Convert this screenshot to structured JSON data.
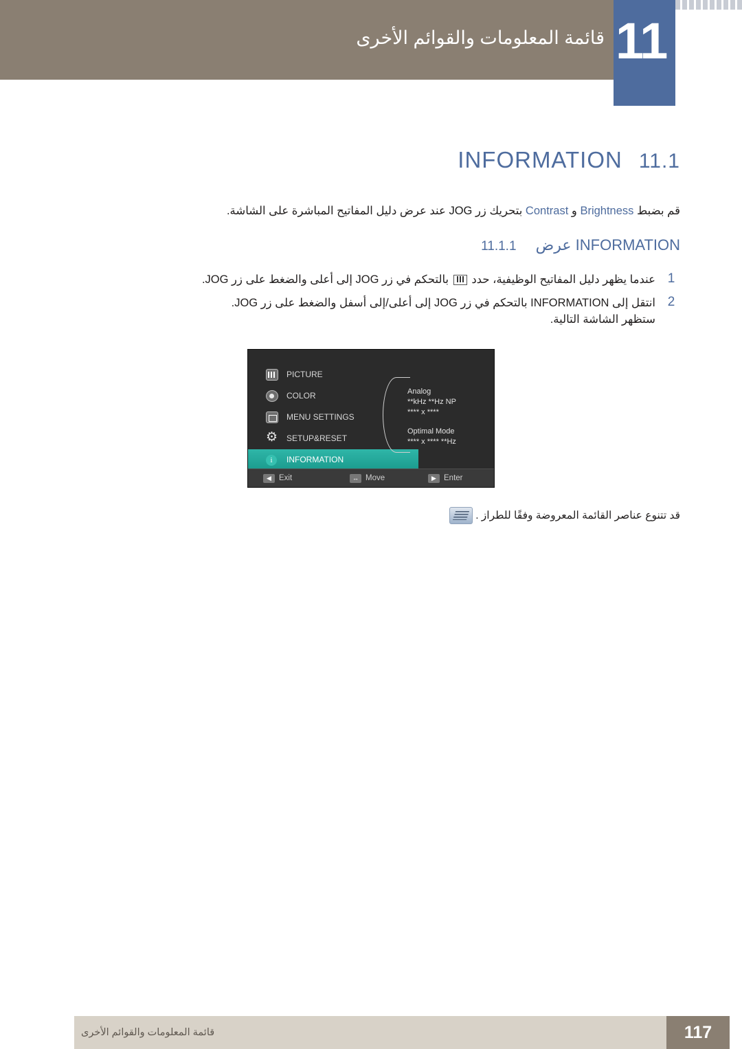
{
  "header": {
    "chapter_number": "11",
    "chapter_title": "قائمة المعلومات والقوائم الأخرى"
  },
  "section": {
    "title_en": "INFORMATION",
    "number": "11.1"
  },
  "lead": {
    "part_right": "قم بضبط",
    "brightness": "Brightness",
    "and": "و",
    "contrast": "Contrast",
    "part_middle": "بتحريك زر",
    "jog": "JOG",
    "part_left": "عند عرض دليل المفاتيح المباشرة على الشاشة."
  },
  "subsection": {
    "number": "11.1.1",
    "label_ar": "عرض",
    "label_en": "INFORMATION"
  },
  "steps": [
    {
      "num": "1",
      "text_a": "عندما يظهر دليل المفاتيح الوظيفية، حدد",
      "text_b": "بالتحكم في زر",
      "jog": "JOG",
      "text_c": "إلى أعلى والضغط على زر",
      "jog2": "JOG",
      "text_d": "."
    },
    {
      "num": "2",
      "text_a": "انتقل إلى",
      "en": "INFORMATION",
      "text_b": "بالتحكم في زر",
      "jog": "JOG",
      "text_c": "إلى أعلى/إلى أسفل والضغط على زر",
      "jog2": "JOG",
      "text_d": ".",
      "sub": "ستظهر الشاشة التالية."
    }
  ],
  "osd": {
    "menu_items": [
      {
        "label": "PICTURE",
        "icon": "picture-bars-icon",
        "selected": false
      },
      {
        "label": "COLOR",
        "icon": "color-palette-icon",
        "selected": false
      },
      {
        "label": "MENU SETTINGS",
        "icon": "menu-settings-icon",
        "selected": false
      },
      {
        "label": "SETUP&RESET",
        "icon": "gear-icon",
        "selected": false
      },
      {
        "label": "INFORMATION",
        "icon": "info-icon",
        "selected": true
      }
    ],
    "info_lines": [
      "Analog",
      "**kHz **Hz NP",
      "**** x ****"
    ],
    "info_lines2": [
      "Optimal Mode",
      "**** x **** **Hz"
    ],
    "buttons": [
      {
        "glyph": "◀",
        "label": "Exit"
      },
      {
        "glyph": "↔",
        "label": "Move"
      },
      {
        "glyph": "▶",
        "label": "Enter"
      }
    ]
  },
  "note": {
    "text": "قد تتنوع عناصر القائمة المعروضة وفقًا للطراز .",
    "icon": "note-book-icon"
  },
  "footer": {
    "title": "قائمة المعلومات والقوائم الأخرى",
    "page": "117"
  },
  "colors": {
    "accent_blue": "#4e6c9e",
    "header_brown": "#8a7f72",
    "footer_band": "#d8d2c8",
    "osd_highlight": "#2fb6a8"
  }
}
